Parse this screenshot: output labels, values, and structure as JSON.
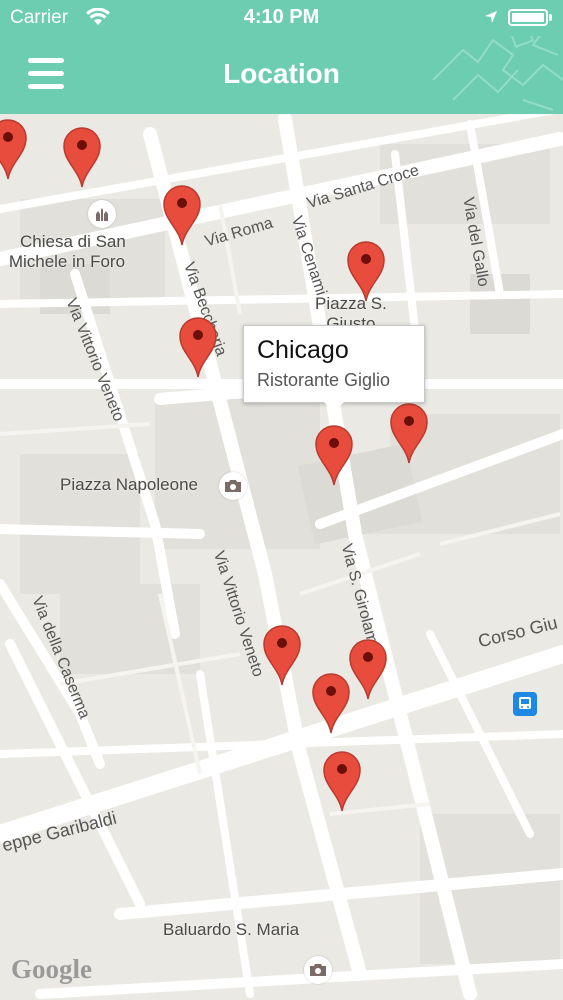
{
  "status_bar": {
    "carrier": "Carrier",
    "time": "4:10 PM"
  },
  "nav": {
    "title": "Location",
    "accent_color": "#6dcdb0",
    "menu_icon": "hamburger-menu-icon"
  },
  "map": {
    "place_labels": [
      {
        "id": "chiesa",
        "lines": [
          "Chiesa di San",
          "Michele in Foro"
        ]
      },
      {
        "id": "piazza-s-giusto",
        "lines": [
          "Piazza S.",
          "Giusto"
        ]
      },
      {
        "id": "piazza-napoleone",
        "lines": [
          "Piazza Napoleone"
        ]
      },
      {
        "id": "baluardo",
        "lines": [
          "Baluardo S. Maria"
        ]
      }
    ],
    "street_labels": {
      "via_roma": "Via Roma",
      "via_santa_croce": "Via Santa Croce",
      "via_cenami": "Via Cenami",
      "via_del_gallo": "Via del Gallo",
      "via_beccheria": "Via Beccheria",
      "via_vittorio_veneto_1": "Via Vittorio Veneto",
      "via_vittorio_veneto_2": "Via Vittorio Veneto",
      "via_s_girolamo": "Via S. Girolamo",
      "corso_giuseppe_garibaldi": "eppe Garibaldi",
      "corso_g": "Corso Giu",
      "via_della_caserma": "Via della Caserma"
    },
    "attribution": "Google",
    "marker_color": "#e74c3c",
    "callout": {
      "title": "Chicago",
      "subtitle": "Ristorante Giglio"
    }
  }
}
